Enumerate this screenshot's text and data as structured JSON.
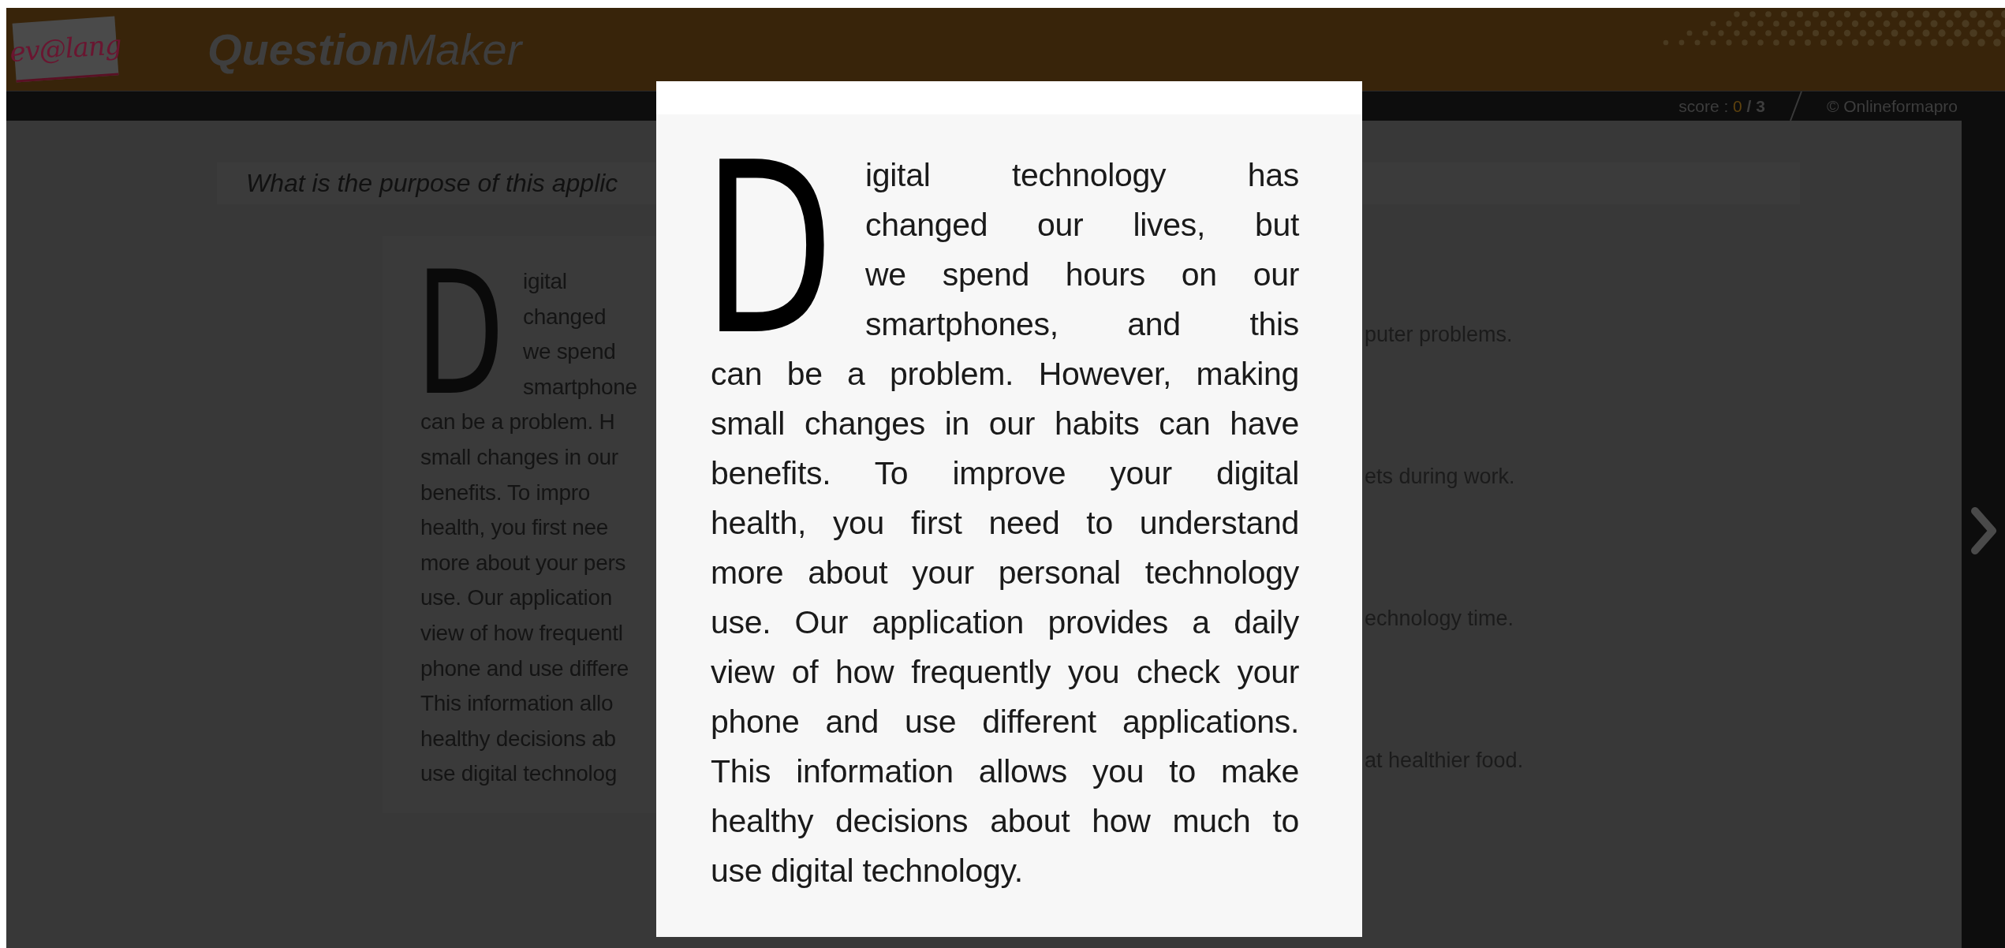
{
  "header": {
    "logo": "ev@lang",
    "title": "**Question**Maker"
  },
  "score_bar": {
    "label": "score : ",
    "score": "0",
    "total": "/ 3",
    "copyright": "© Onlineformapro"
  },
  "question": {
    "text": "What is the purpose of this applic"
  },
  "background_passage": {
    "drop_cap": "D",
    "lines": [
      "igital",
      "changed",
      "we spend",
      "smartphone",
      "can be a problem. H",
      "small changes in our",
      "benefits. To impro",
      "health, you first nee",
      "more about your pers",
      "use. Our application",
      "view of how frequentl",
      "phone and use differe",
      "This information allo",
      "healthy decisions ab",
      "use digital technolog"
    ]
  },
  "options": [
    "puter problems.",
    "ets during work.",
    "echnology time.",
    "at healthier food."
  ],
  "lightbox": {
    "drop_cap": "D",
    "lines": [
      "igital technology has",
      "changed our lives, but",
      "we spend hours on our",
      "smartphones, and this",
      "can be a problem. However, making",
      "small changes in our habits can have",
      "benefits. To improve your digital",
      "health, you first need to understand",
      "more about your personal technology",
      "use. Our application provides a daily",
      "view of how frequently you check your",
      "phone and use different applications.",
      "This information allows you to make",
      "healthy decisions about how much to",
      "use digital technology."
    ]
  }
}
